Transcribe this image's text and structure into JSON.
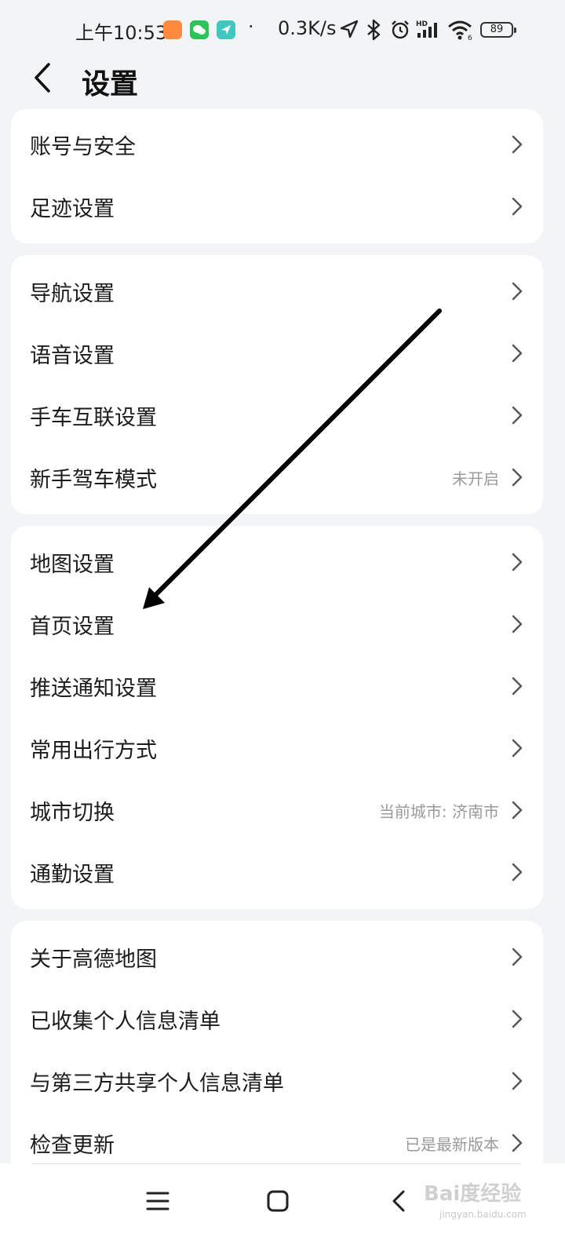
{
  "status_bar": {
    "time": "上午10:53",
    "dot": "·",
    "net_speed": "0.3K/s",
    "battery": "89",
    "icons": [
      "app-orange-icon",
      "wechat-icon",
      "location-app-icon",
      "location-arrow-icon",
      "bluetooth-icon",
      "alarm-icon",
      "hd-signal-icon",
      "wifi-icon",
      "battery-icon"
    ]
  },
  "header": {
    "title": "设置",
    "back_icon": "chevron-left-icon"
  },
  "groups": [
    {
      "items": [
        {
          "label": "账号与安全",
          "value": ""
        },
        {
          "label": "足迹设置",
          "value": ""
        }
      ]
    },
    {
      "items": [
        {
          "label": "导航设置",
          "value": ""
        },
        {
          "label": "语音设置",
          "value": ""
        },
        {
          "label": "手车互联设置",
          "value": ""
        },
        {
          "label": "新手驾车模式",
          "value": "未开启"
        }
      ]
    },
    {
      "items": [
        {
          "label": "地图设置",
          "value": ""
        },
        {
          "label": "首页设置",
          "value": ""
        },
        {
          "label": "推送通知设置",
          "value": ""
        },
        {
          "label": "常用出行方式",
          "value": ""
        },
        {
          "label": "城市切换",
          "value": "当前城市: 济南市"
        },
        {
          "label": "通勤设置",
          "value": ""
        }
      ]
    },
    {
      "items": [
        {
          "label": "关于高德地图",
          "value": ""
        },
        {
          "label": "已收集个人信息清单",
          "value": ""
        },
        {
          "label": "与第三方共享个人信息清单",
          "value": ""
        },
        {
          "label": "检查更新",
          "value": "已是最新版本"
        }
      ]
    }
  ],
  "nav_bar": {
    "icons": [
      "menu-icon",
      "home-icon",
      "back-icon"
    ]
  },
  "watermark": {
    "text": "Bai度经验",
    "sub": "jingyan.baidu.com"
  },
  "colors": {
    "background": "#f3f4f6",
    "card": "#ffffff",
    "text": "#1c1c1c",
    "secondary_text": "#9a9a9a",
    "annotation_arrow": "#000000"
  }
}
